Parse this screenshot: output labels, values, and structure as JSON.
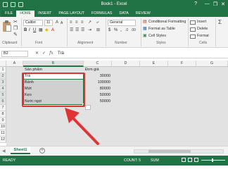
{
  "window": {
    "title": "Book1 - Excel",
    "help": "?",
    "minimize": "—",
    "restore": "❐",
    "close": "✕"
  },
  "tabs": [
    "FILE",
    "HOME",
    "INSERT",
    "PAGE LAYOUT",
    "FORMULAS",
    "DATA",
    "REVIEW"
  ],
  "ribbon": {
    "font_name": "Calibri",
    "font_size": "11",
    "bold": "B",
    "italic": "I",
    "underline": "U",
    "number_format": "General",
    "currency_symbol": "$",
    "percent_symbol": "%",
    "comma_symbol": ",",
    "conditional_formatting": "Conditional Formatting",
    "format_as_table": "Format as Table",
    "cell_styles": "Cell Styles",
    "insert": "Insert",
    "delete": "Delete",
    "format": "Format",
    "group_clipboard": "Clipboard",
    "group_font": "Font",
    "group_alignment": "Alignment",
    "group_number": "Number",
    "group_styles": "Styles",
    "group_cells": "Cells"
  },
  "formula_bar": {
    "name_box": "B2",
    "fx": "fx",
    "value": "Trà"
  },
  "columns": [
    "A",
    "B",
    "C",
    "D",
    "E",
    "F",
    "G"
  ],
  "rows": [
    "1",
    "2",
    "3",
    "4",
    "5",
    "6",
    "7",
    "8",
    "9",
    "10",
    "11",
    "12"
  ],
  "cells": {
    "B1": "Sản phẩm",
    "C1": "Đơn giá",
    "products": [
      "Trà",
      "Bánh",
      "Mứt",
      "Kẹo",
      "Nước ngọt"
    ],
    "prices": [
      "30000",
      "100000",
      "80000",
      "50000",
      "50000"
    ]
  },
  "sheet_tabs": [
    "Sheet1"
  ],
  "status": {
    "ready": "READY",
    "count": "COUNT: 5",
    "sum": "SUM"
  },
  "colors": {
    "brand": "#217346",
    "highlight_box": "#e03434",
    "selection": "#d0d0d0"
  }
}
